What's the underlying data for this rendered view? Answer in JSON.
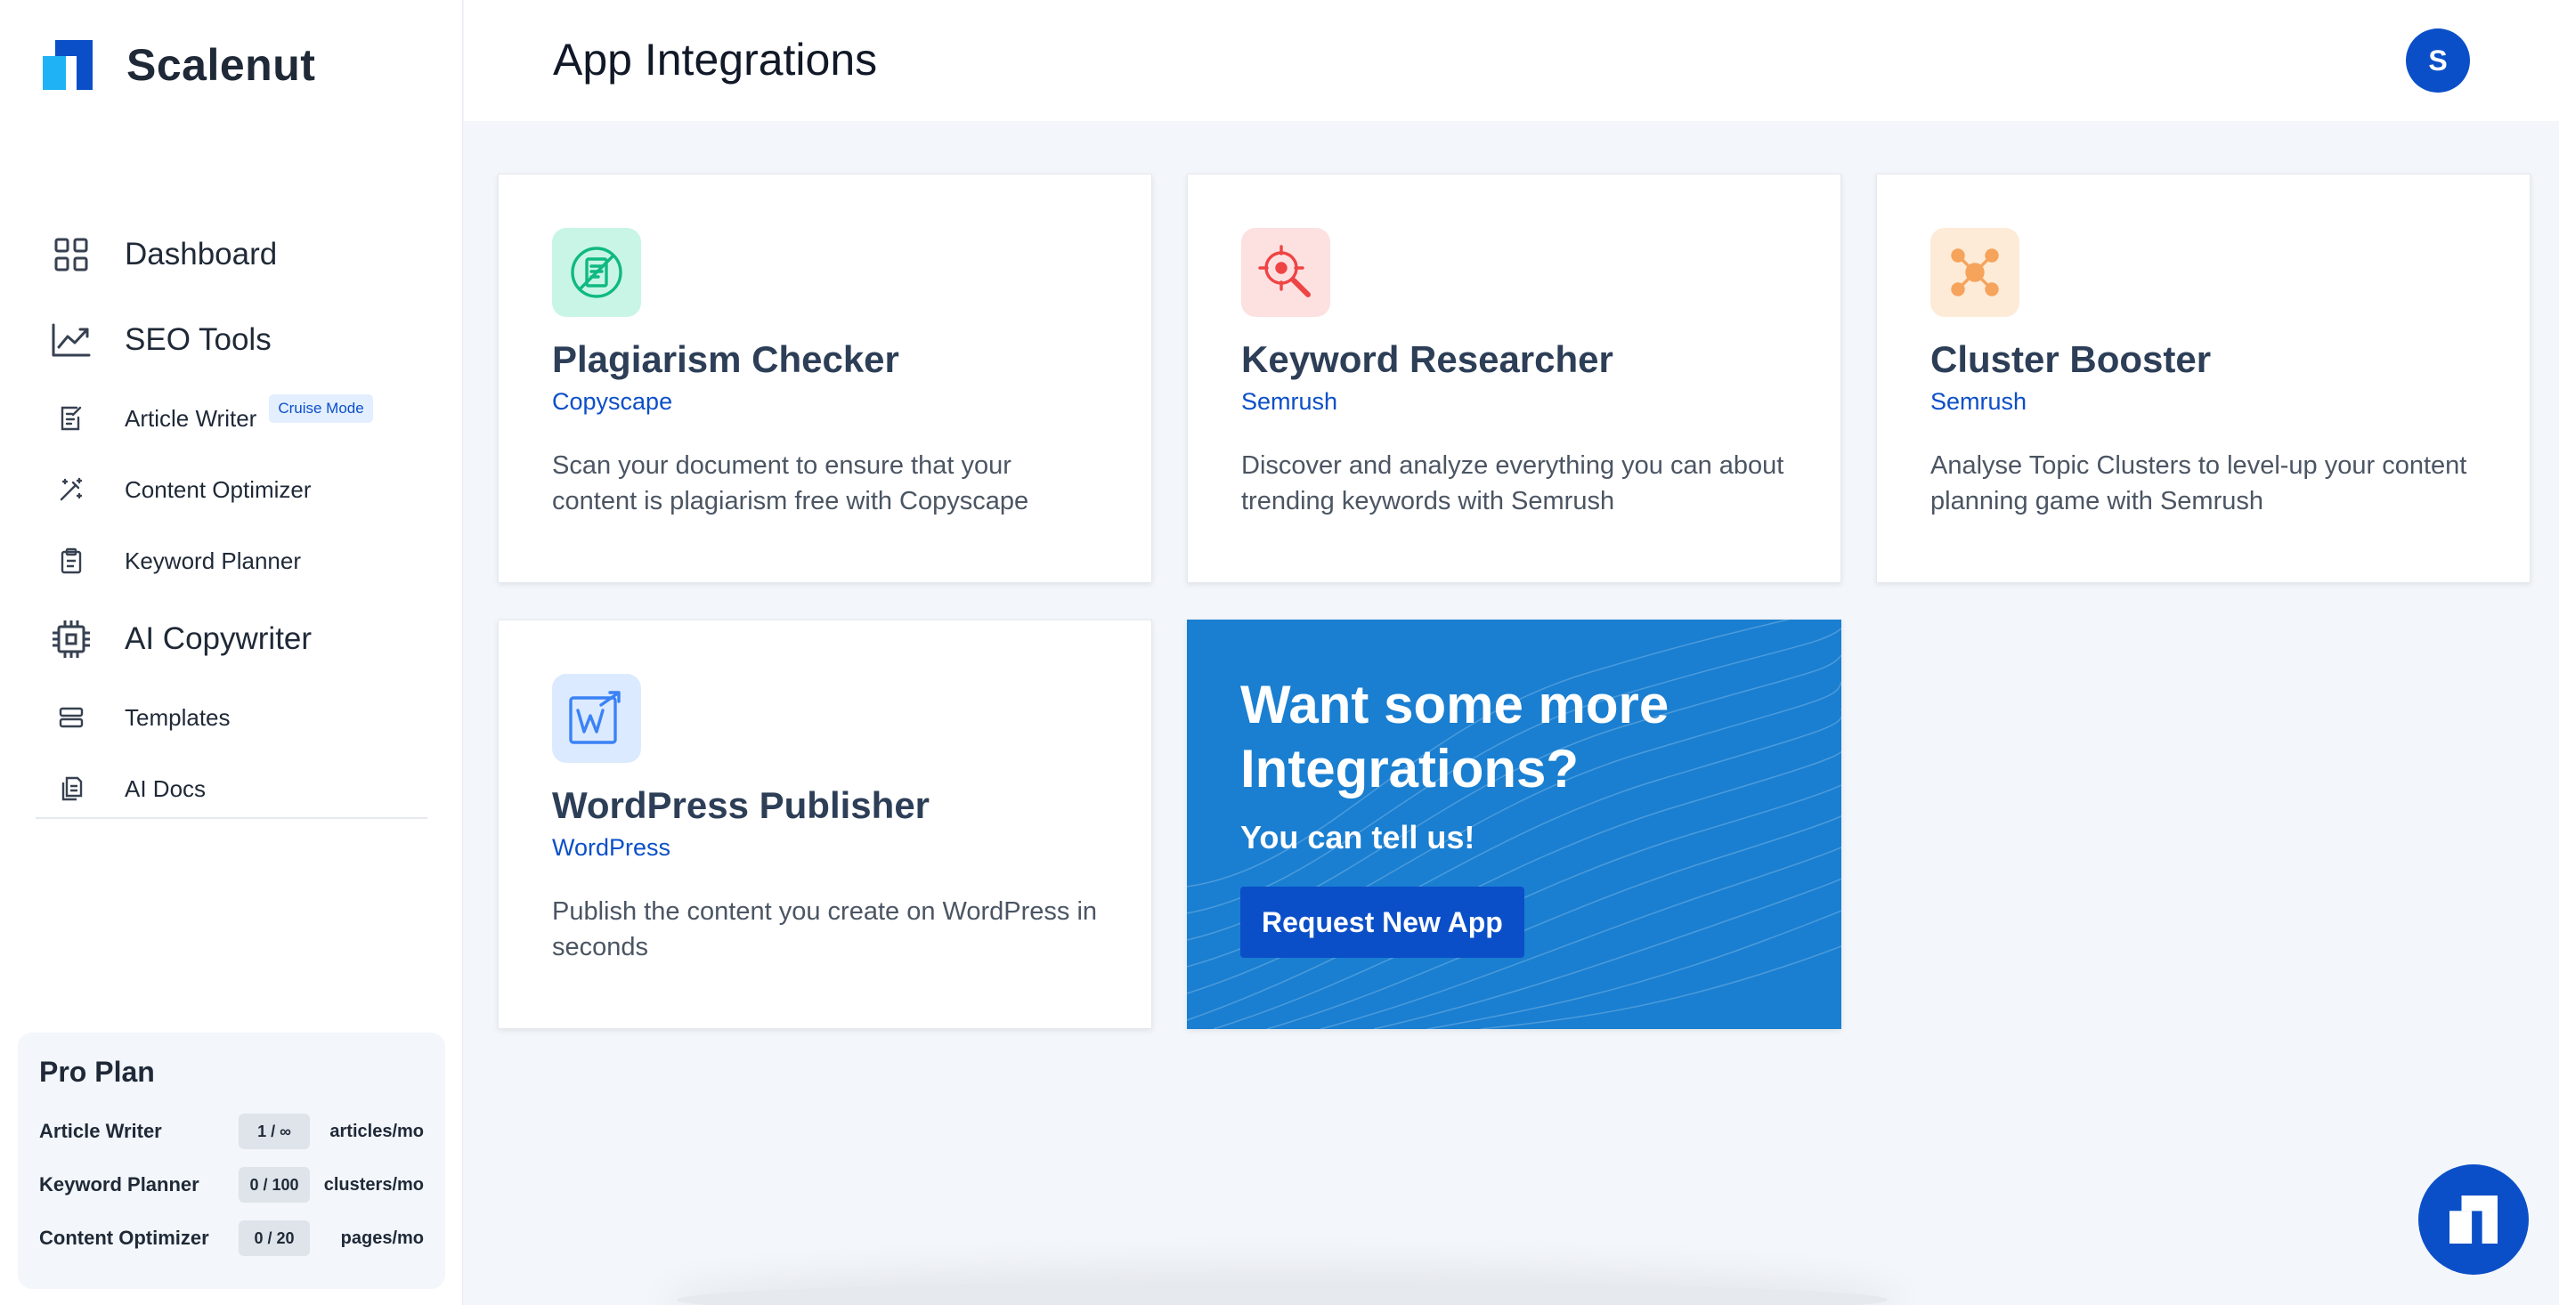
{
  "brand": {
    "name": "Scalenut"
  },
  "header": {
    "title": "App Integrations",
    "avatar_initial": "S"
  },
  "sidebar": {
    "items": [
      {
        "label": "Dashboard",
        "icon": "grid-icon"
      },
      {
        "label": "SEO Tools",
        "icon": "trend-chart-icon"
      },
      {
        "label": "Article Writer",
        "icon": "edit-doc-icon",
        "badge": "Cruise Mode"
      },
      {
        "label": "Content Optimizer",
        "icon": "magic-wand-icon"
      },
      {
        "label": "Keyword Planner",
        "icon": "clipboard-icon"
      },
      {
        "label": "AI Copywriter",
        "icon": "cpu-chip-icon"
      },
      {
        "label": "Templates",
        "icon": "templates-icon"
      },
      {
        "label": "AI Docs",
        "icon": "docs-icon"
      }
    ]
  },
  "plan": {
    "title": "Pro Plan",
    "rows": [
      {
        "name": "Article Writer",
        "usage": "1 / ∞",
        "unit": "articles/mo"
      },
      {
        "name": "Keyword Planner",
        "usage": "0 / 100",
        "unit": "clusters/mo"
      },
      {
        "name": "Content Optimizer",
        "usage": "0 / 20",
        "unit": "pages/mo"
      }
    ]
  },
  "cards": [
    {
      "title": "Plagiarism Checker",
      "vendor": "Copyscape",
      "desc": "Scan your document to ensure that your content is plagiarism free with Copyscape",
      "icon": "plagiarism-icon",
      "icon_bg": "#c9f5e7",
      "icon_color": "#10b981"
    },
    {
      "title": "Keyword Researcher",
      "vendor": "Semrush",
      "desc": "Discover and analyze everything you can about trending keywords with Semrush",
      "icon": "target-search-icon",
      "icon_bg": "#fde0e0",
      "icon_color": "#ef4444"
    },
    {
      "title": "Cluster Booster",
      "vendor": "Semrush",
      "desc": "Analyse Topic Clusters to level-up your content planning game with Semrush",
      "icon": "cluster-icon",
      "icon_bg": "#fdebd7",
      "icon_color": "#f6a35c"
    },
    {
      "title": "WordPress Publisher",
      "vendor": "WordPress",
      "desc": "Publish the content you create on WordPress in seconds",
      "icon": "wordpress-icon",
      "icon_bg": "#dbeafe",
      "icon_color": "#3b82f6"
    }
  ],
  "promo": {
    "title": "Want some more Integrations?",
    "subtitle": "You can tell us!",
    "button": "Request New App"
  },
  "colors": {
    "primary": "#0b4fc8",
    "brand_light": "#1fb3f5",
    "promo_bg": "#1a7fd1"
  }
}
